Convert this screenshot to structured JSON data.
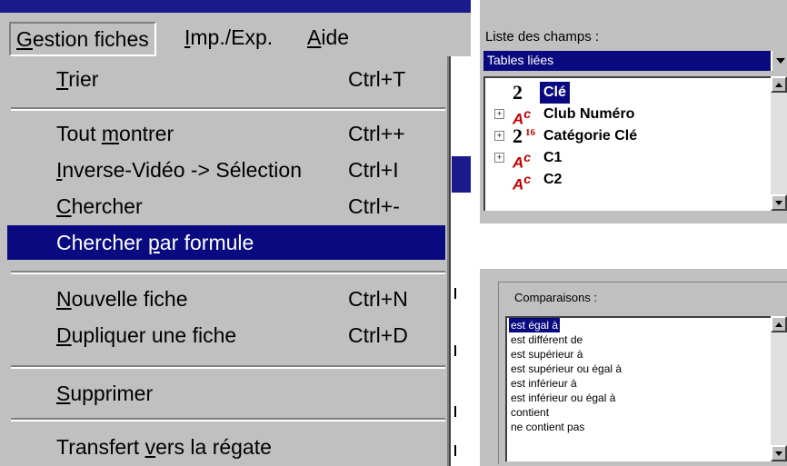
{
  "menubar": {
    "items": [
      {
        "label": "Gestion fiches",
        "mnemonic": "G",
        "rest": "estion fiches"
      },
      {
        "label": "Imp./Exp.",
        "mnemonic": "I",
        "rest": "mp./Exp."
      },
      {
        "label": "Aide",
        "mnemonic": "A",
        "rest": "ide"
      }
    ]
  },
  "menu": {
    "items": [
      {
        "pre": "",
        "mn": "T",
        "post": "rier",
        "shortcut": "Ctrl+T"
      },
      {
        "pre": "Tout ",
        "mn": "m",
        "post": "ontrer",
        "shortcut": "Ctrl++"
      },
      {
        "pre": "",
        "mn": "I",
        "post": "nverse-Vidéo -> Sélection",
        "shortcut": "Ctrl+I"
      },
      {
        "pre": "",
        "mn": "C",
        "post": "hercher",
        "shortcut": "Ctrl+-"
      },
      {
        "pre": "Chercher ",
        "mn": "p",
        "post": "ar formule",
        "shortcut": ""
      },
      {
        "pre": "",
        "mn": "N",
        "post": "ouvelle fiche",
        "shortcut": "Ctrl+N"
      },
      {
        "pre": "",
        "mn": "D",
        "post": "upliquer une fiche",
        "shortcut": "Ctrl+D"
      },
      {
        "pre": "",
        "mn": "S",
        "post": "upprimer",
        "shortcut": ""
      },
      {
        "pre": "Transfert ",
        "mn": "v",
        "post": "ers la régate",
        "shortcut": ""
      }
    ]
  },
  "fields": {
    "caption": "Liste des champs :",
    "combo_value": "Tables liées",
    "rows": [
      {
        "label": "Clé",
        "icon": "2",
        "sup": ""
      },
      {
        "label": "Club Numéro",
        "icon": "A",
        "sup": "c"
      },
      {
        "label": "Catégorie Clé",
        "icon": "2",
        "sup": "16"
      },
      {
        "label": "C1",
        "icon": "A",
        "sup": "c"
      },
      {
        "label": "C2",
        "icon": "A",
        "sup": "c"
      }
    ]
  },
  "comparisons": {
    "caption": "Comparaisons :",
    "items": [
      "est égal à",
      "est différent de",
      "est supérieur à",
      "est supérieur ou égal à",
      "est inférieur à",
      "est inférieur ou égal à",
      "contient",
      "ne contient pas"
    ]
  },
  "colors": {
    "highlight": "#0a0a80",
    "face": "#c0c0c0"
  }
}
